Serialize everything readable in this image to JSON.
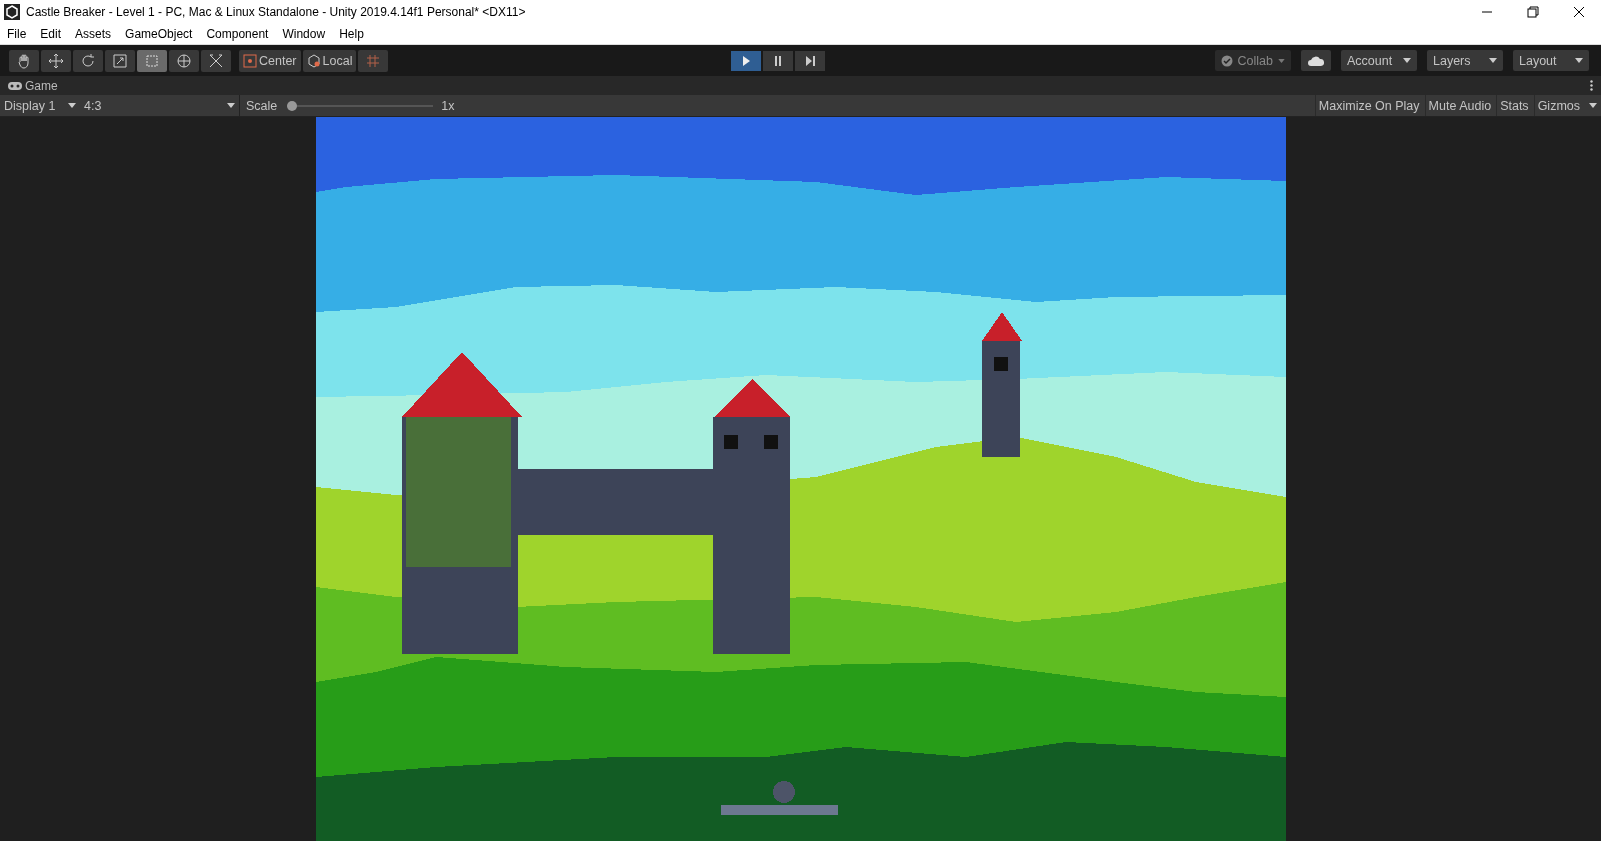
{
  "window": {
    "title": "Castle Breaker - Level 1 - PC, Mac & Linux Standalone - Unity 2019.4.14f1 Personal* <DX11>"
  },
  "menu": [
    "File",
    "Edit",
    "Assets",
    "GameObject",
    "Component",
    "Window",
    "Help"
  ],
  "tools": [
    {
      "kind": "hand",
      "selected": false
    },
    {
      "kind": "move",
      "selected": false
    },
    {
      "kind": "rotate",
      "selected": false
    },
    {
      "kind": "scale",
      "selected": false
    },
    {
      "kind": "rect",
      "selected": true
    },
    {
      "kind": "transform",
      "selected": false
    },
    {
      "kind": "custom",
      "selected": false
    }
  ],
  "pivot": [
    {
      "kind": "center",
      "label": "Center"
    },
    {
      "kind": "local",
      "label": "Local"
    },
    {
      "kind": "grid"
    }
  ],
  "playback": [
    {
      "kind": "play",
      "selected": true
    },
    {
      "kind": "pause",
      "selected": false
    },
    {
      "kind": "step",
      "selected": false
    }
  ],
  "right": {
    "collab": "Collab",
    "account": "Account",
    "layers": "Layers",
    "layout": "Layout"
  },
  "game_tab": {
    "label": "Game"
  },
  "game_toolbar": {
    "display": "Display 1",
    "aspect": "4:3",
    "scale_label": "Scale",
    "scale": {
      "level": 0.0
    },
    "scale_value": "1x",
    "toggles": [
      {
        "label": "Maximize On Play",
        "selected": false
      },
      {
        "label": "Mute Audio",
        "selected": false
      },
      {
        "label": "Stats",
        "selected": false
      },
      {
        "label": "Gizmos",
        "selected": false
      }
    ]
  }
}
